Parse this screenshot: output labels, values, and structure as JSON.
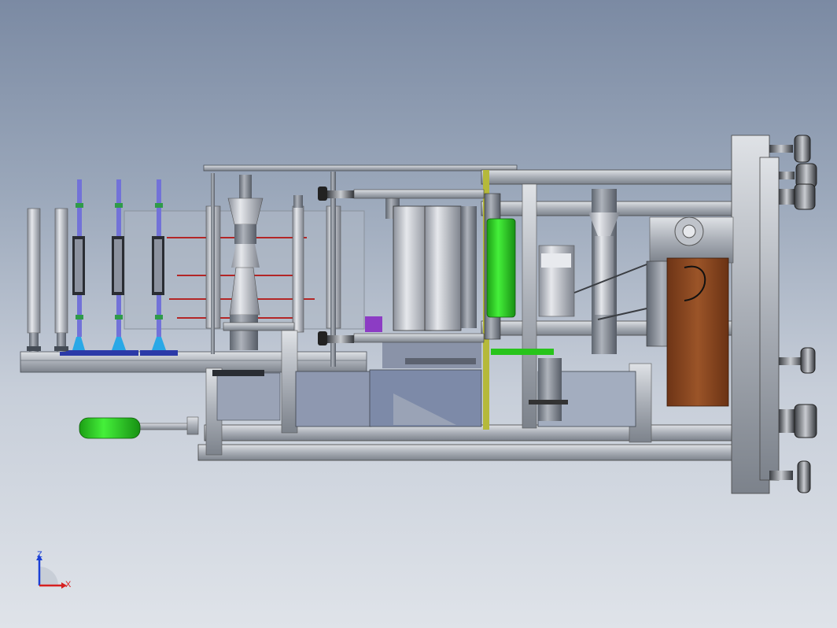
{
  "viewport": {
    "background_top": "#7b8aa3",
    "background_bottom": "#dfe3e9"
  },
  "model": {
    "frame_color": "#b9bec6",
    "motor_color": "#8f4a22",
    "roller_green": "#27d41b",
    "handle_green": "#1fb51f",
    "rod_blue": "#7272d8",
    "cone_blue": "#29a8e6",
    "red_wire": "#b32626"
  },
  "triad": {
    "z_label": "Z",
    "x_label": "X",
    "z_color": "#1a3fd6",
    "x_color": "#d62020"
  }
}
